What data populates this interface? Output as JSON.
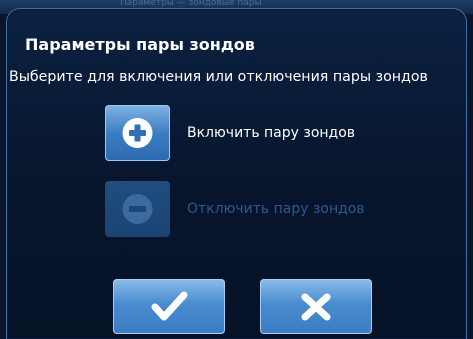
{
  "backdrop": {
    "text": "Параметры — зондовые пары"
  },
  "dialog": {
    "title": "Параметры пары зондов",
    "subtitle": "Выберите для включения или отключения пары зондов",
    "options": [
      {
        "label": "Включить пару зондов",
        "icon": "plus-circle-icon",
        "enabled": true
      },
      {
        "label": "Отключить пару зондов",
        "icon": "minus-circle-icon",
        "enabled": false
      }
    ],
    "buttons": {
      "confirm_icon": "checkmark-icon",
      "cancel_icon": "close-icon"
    }
  },
  "colors": {
    "dialog_bg": "#07152c",
    "dialog_border": "#3f6ea6",
    "button_blue": "#4a8bcf",
    "disabled_text": "#2a5a8f",
    "text": "#ffffff"
  }
}
